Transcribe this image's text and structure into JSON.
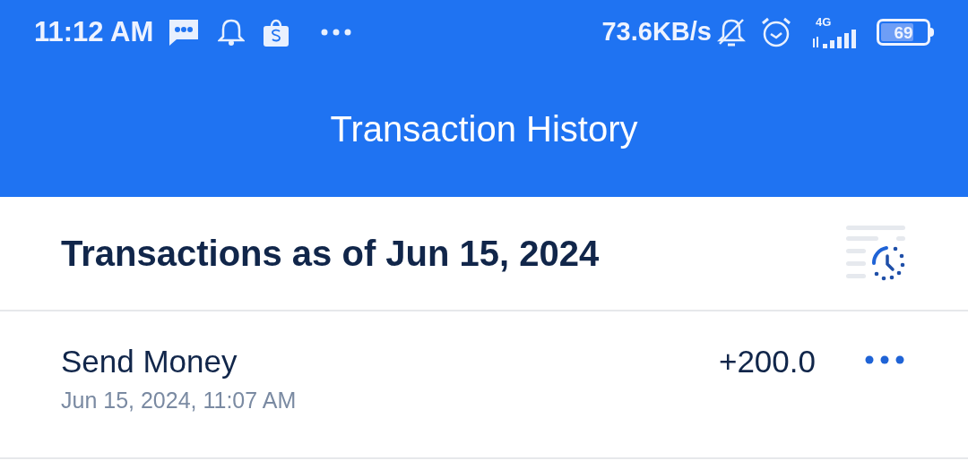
{
  "status_bar": {
    "time": "11:12 AM",
    "speed": "73.6KB/s",
    "network": "4G",
    "battery": "69"
  },
  "header": {
    "title": "Transaction History"
  },
  "section": {
    "title": "Transactions as of Jun 15, 2024"
  },
  "transactions": [
    {
      "title": "Send Money",
      "datetime": "Jun 15, 2024, 11:07 AM",
      "amount": "+200.0"
    }
  ]
}
